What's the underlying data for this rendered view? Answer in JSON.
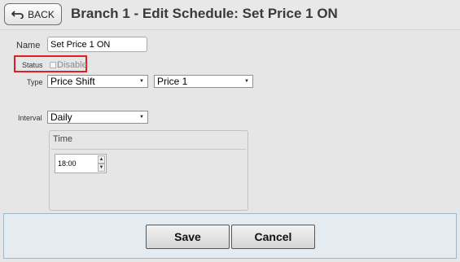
{
  "header": {
    "back_label": "BACK",
    "title": "Branch 1 - Edit Schedule: Set Price 1 ON"
  },
  "form": {
    "name_label": "Name",
    "name_value": "Set Price 1 ON",
    "status_label": "Status",
    "disable_label": "Disable",
    "disable_checked": false,
    "type_label": "Type",
    "type_selected": "Price Shift",
    "price_selected": "Price 1",
    "interval_label": "Interval",
    "interval_selected": "Daily"
  },
  "time_panel": {
    "legend": "Time",
    "time_value": "18:00"
  },
  "footer": {
    "save_label": "Save",
    "cancel_label": "Cancel"
  },
  "colors": {
    "status_highlight": "#e02020",
    "footer_bg": "#e4ebf1",
    "footer_border": "#9fb7c7"
  },
  "icons": {
    "back": "return-arrow-icon",
    "select": "dropdown-arrow-icon",
    "spinner_up": "spinner-up-icon",
    "spinner_down": "spinner-down-icon"
  }
}
